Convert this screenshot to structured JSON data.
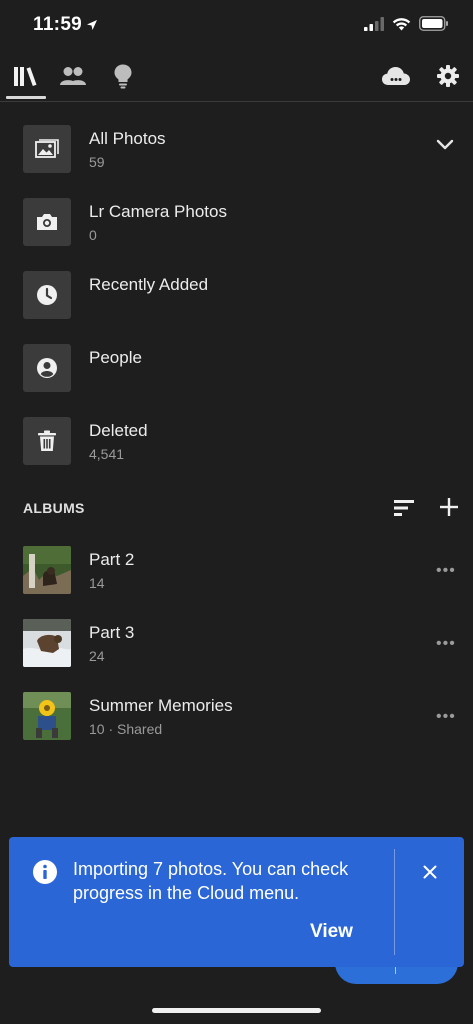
{
  "status_bar": {
    "time": "11:59"
  },
  "nav": {
    "tabs": [
      "library-icon",
      "people-icon",
      "learn-icon"
    ],
    "actions": [
      "cloud-icon",
      "gear-icon"
    ]
  },
  "sources": [
    {
      "label": "All Photos",
      "count": "59",
      "icon": "photos-icon"
    },
    {
      "label": "Lr Camera Photos",
      "count": "0",
      "icon": "camera-icon"
    },
    {
      "label": "Recently Added",
      "count": "",
      "icon": "clock-icon"
    },
    {
      "label": "People",
      "count": "",
      "icon": "person-icon"
    },
    {
      "label": "Deleted",
      "count": "4,541",
      "icon": "trash-icon"
    }
  ],
  "albums": {
    "header": "ALBUMS",
    "items": [
      {
        "name": "Part 2",
        "meta": "14"
      },
      {
        "name": "Part 3",
        "meta": "24"
      },
      {
        "name": "Summer Memories",
        "meta": "10 · Shared"
      }
    ]
  },
  "toast": {
    "message": "Importing 7 photos. You can check progress in the Cloud menu.",
    "action": "View"
  },
  "colors": {
    "accent": "#2a66d6",
    "background": "#1e1e1e",
    "tile": "#3b3b3b"
  }
}
